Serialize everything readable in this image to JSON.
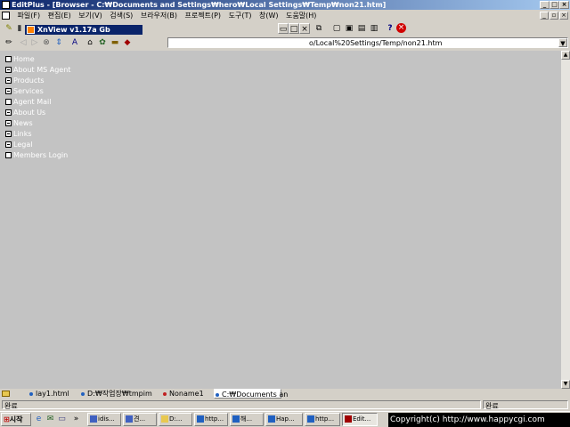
{
  "window": {
    "title": "EditPlus - [Browser - C:₩Documents and Settings₩hero₩Local Settings₩Temp₩non21.htm]"
  },
  "menu": [
    "파일(F)",
    "편집(E)",
    "보기(V)",
    "검색(S)",
    "브라우저(B)",
    "프로젝트(P)",
    "도구(T)",
    "창(W)",
    "도움말(H)"
  ],
  "xnview": {
    "title": "XnView v1.17a Gb"
  },
  "address": {
    "value": "o/Local%20Settings/Temp/non21.htm"
  },
  "nav": [
    {
      "label": "Home",
      "icon": "closed-box"
    },
    {
      "label": "About MS Agent",
      "icon": "open-box"
    },
    {
      "label": "Products",
      "icon": "open-box"
    },
    {
      "label": "Services",
      "icon": "open-box"
    },
    {
      "label": "Agent Mail",
      "icon": "closed-box"
    },
    {
      "label": "About Us",
      "icon": "open-box"
    },
    {
      "label": "News",
      "icon": "open-box"
    },
    {
      "label": "Links",
      "icon": "open-box"
    },
    {
      "label": "Legal",
      "icon": "open-box"
    },
    {
      "label": "Members Login",
      "icon": "closed-box"
    }
  ],
  "tabs": [
    {
      "label": "lay1.html",
      "color": "#2060c0"
    },
    {
      "label": "D:₩작업장₩tmpim",
      "color": "#2060c0"
    },
    {
      "label": "Noname1",
      "color": "#c02020"
    },
    {
      "label": "C:₩Documents an",
      "color": "#2060c0"
    }
  ],
  "status": {
    "left": "완료",
    "right": "완료"
  },
  "taskbar": {
    "start": "시작",
    "buttons": [
      "idis...",
      "견...",
      "D:...",
      "http...",
      "해...",
      "Hap...",
      "http...",
      "Edit..."
    ]
  },
  "copyright": "Copyright(c) http://www.happycgi.com",
  "colors": {
    "titlebar": "#0a246a",
    "content_bg": "#c3c3c3",
    "nav_text": "#ffffff"
  }
}
